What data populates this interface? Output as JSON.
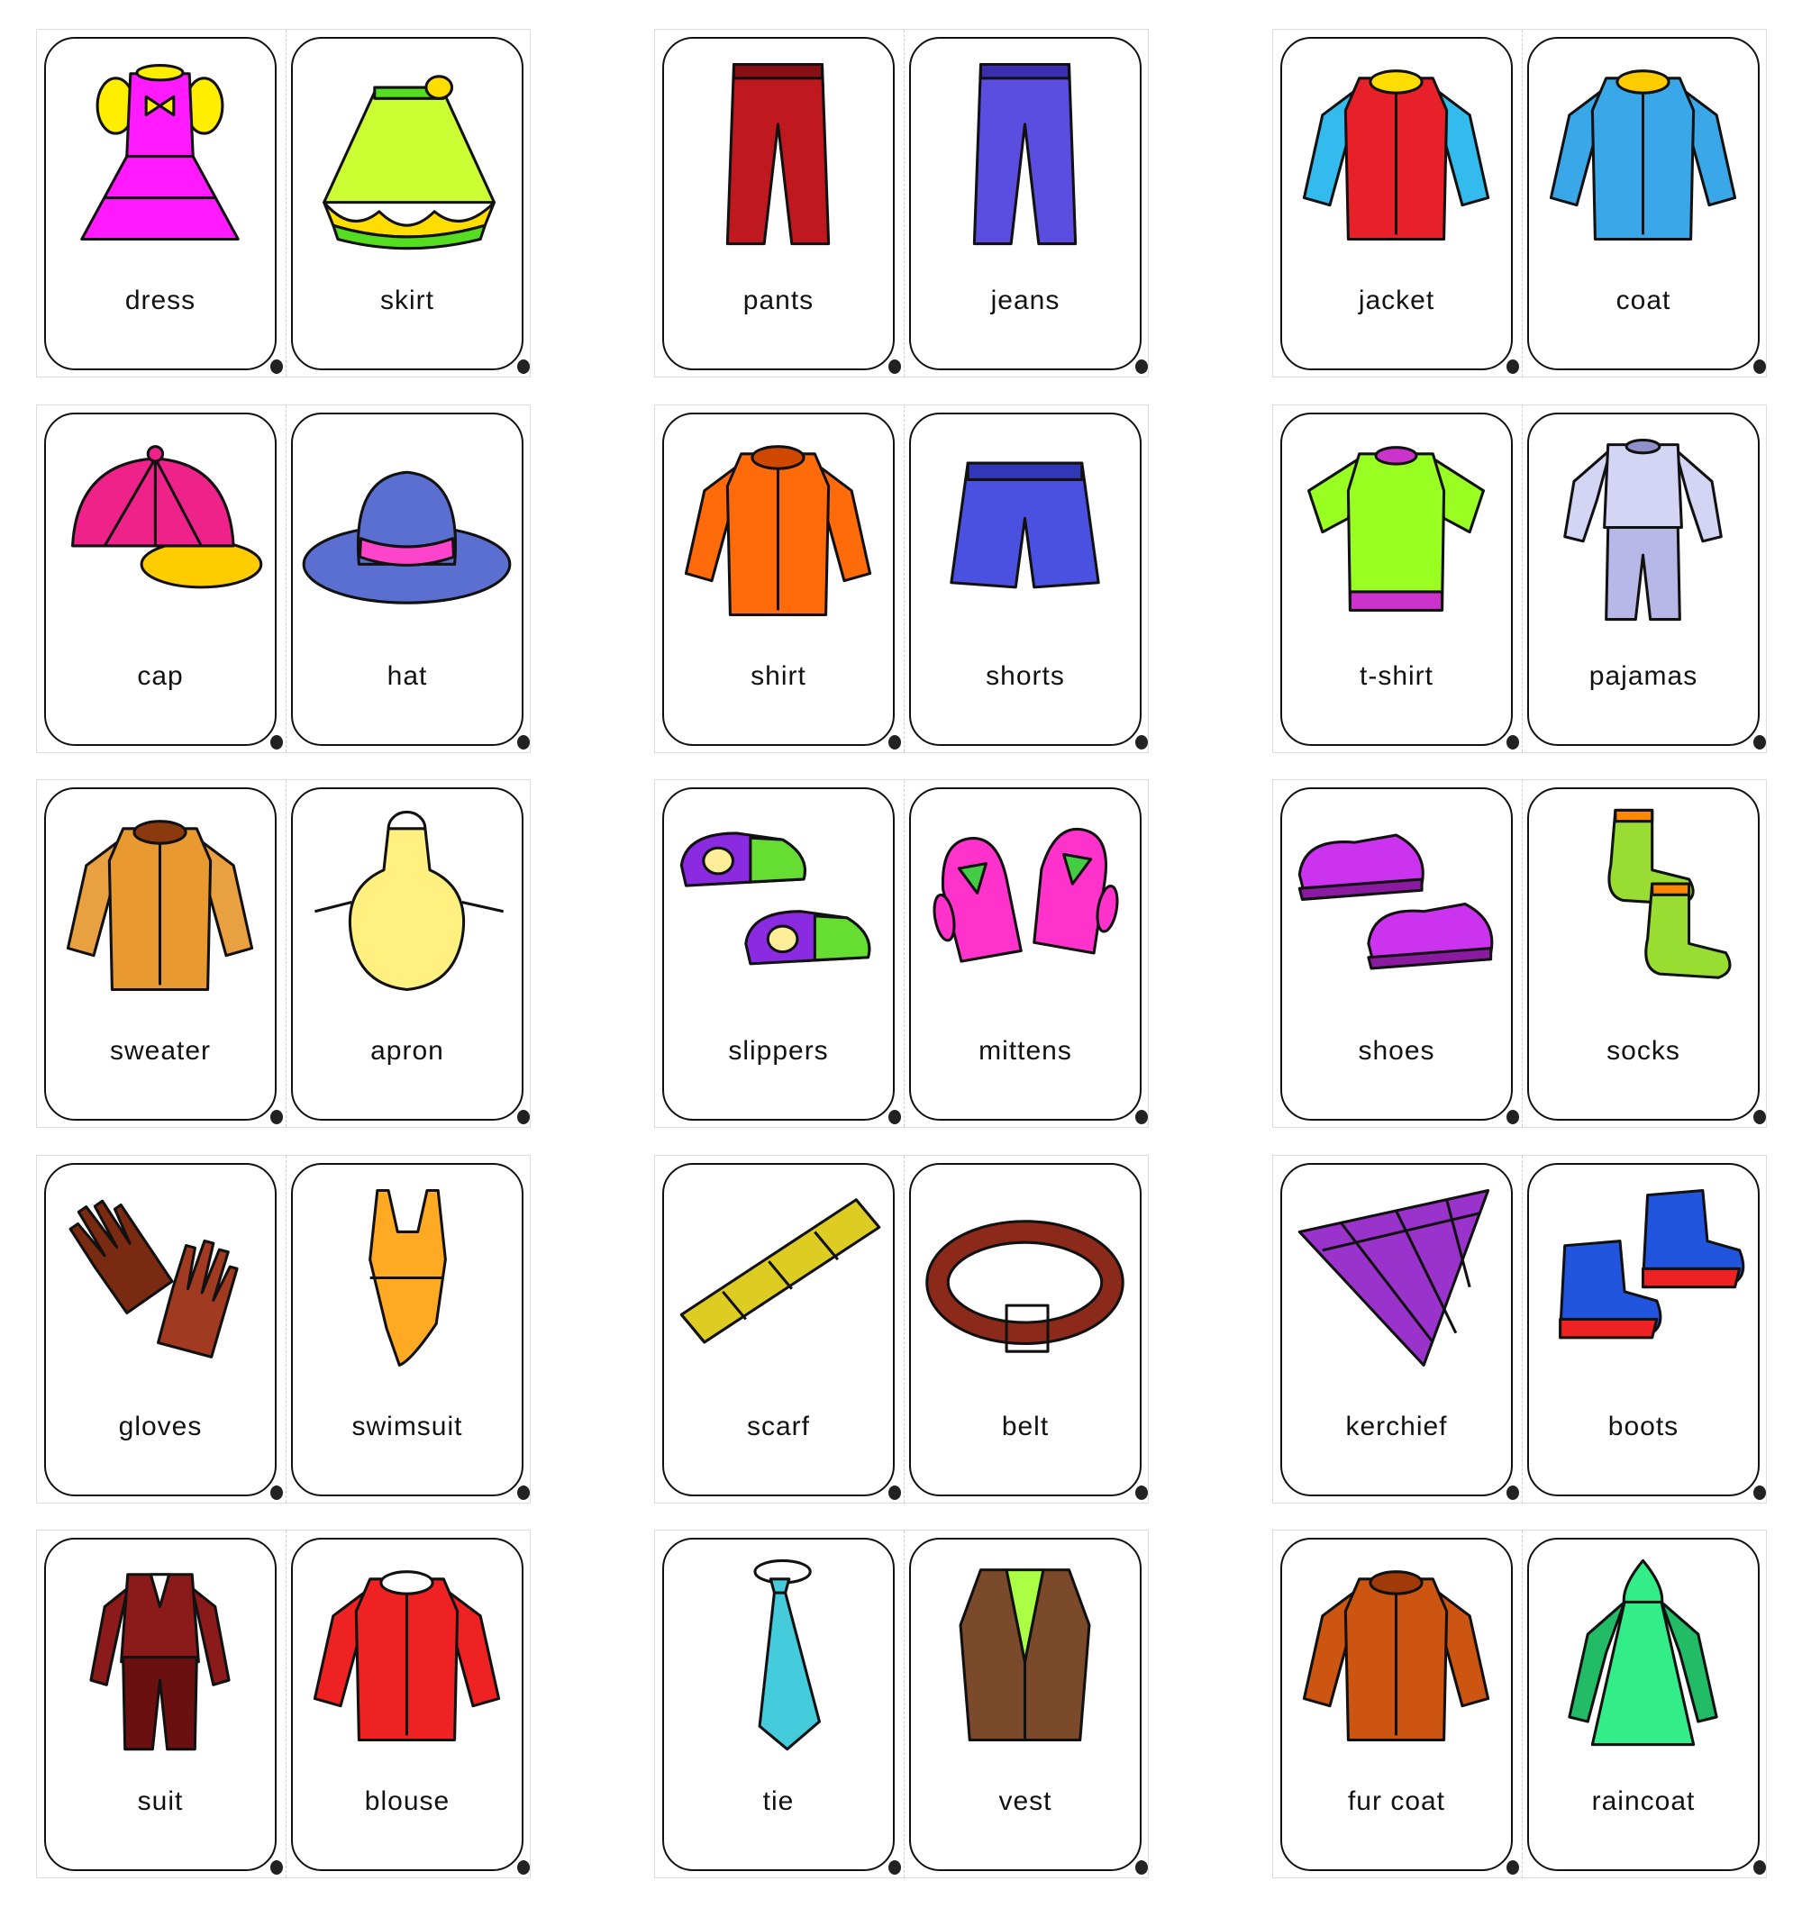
{
  "rows": [
    [
      {
        "label": "dress",
        "shape": "dress",
        "colors": [
          "#ff1aff",
          "#ffee00",
          "#b400c8"
        ]
      },
      {
        "label": "skirt",
        "shape": "skirt",
        "colors": [
          "#ccff33",
          "#ffdd00",
          "#55dd22"
        ]
      },
      {
        "label": "pants",
        "shape": "pants",
        "colors": [
          "#c0181f",
          "#8a0f14",
          "#8a0f14"
        ]
      },
      {
        "label": "jeans",
        "shape": "pants",
        "colors": [
          "#5b4de0",
          "#3a2fb0",
          "#3a2fb0"
        ]
      },
      {
        "label": "jacket",
        "shape": "top",
        "colors": [
          "#e8202a",
          "#33bbee",
          "#ffdd00"
        ]
      },
      {
        "label": "coat",
        "shape": "top",
        "colors": [
          "#3aa8e8",
          "#3aa8e8",
          "#ffcc00"
        ]
      }
    ],
    [
      {
        "label": "cap",
        "shape": "cap",
        "colors": [
          "#ee2288",
          "#ffcc00",
          "#ffee33"
        ]
      },
      {
        "label": "hat",
        "shape": "hat",
        "colors": [
          "#5a6fd0",
          "#ff44cc",
          "#4455bb"
        ]
      },
      {
        "label": "shirt",
        "shape": "top",
        "colors": [
          "#ff6a0a",
          "#ff6a0a",
          "#d04800"
        ]
      },
      {
        "label": "shorts",
        "shape": "shorts",
        "colors": [
          "#4a50e0",
          "#3038b8",
          "#3038b8"
        ]
      },
      {
        "label": "t-shirt",
        "shape": "tshirt",
        "colors": [
          "#99ff22",
          "#99ff22",
          "#cc33cc"
        ]
      },
      {
        "label": "pajamas",
        "shape": "pajamas",
        "colors": [
          "#d4d4f4",
          "#b8b8e8",
          "#9090c8"
        ]
      }
    ],
    [
      {
        "label": "sweater",
        "shape": "top",
        "colors": [
          "#e89a30",
          "#e8a040",
          "#8b3a10"
        ]
      },
      {
        "label": "apron",
        "shape": "apron",
        "colors": [
          "#fff080",
          "#ffcc00",
          "#ffcc00"
        ]
      },
      {
        "label": "slippers",
        "shape": "slippers",
        "colors": [
          "#8a2be2",
          "#66dd33",
          "#ffee99"
        ]
      },
      {
        "label": "mittens",
        "shape": "mittens",
        "colors": [
          "#ff33cc",
          "#44cc44",
          "#ff33cc"
        ]
      },
      {
        "label": "shoes",
        "shape": "shoes",
        "colors": [
          "#cc33ee",
          "#ffcc00",
          "#8a1aa0"
        ]
      },
      {
        "label": "socks",
        "shape": "socks",
        "colors": [
          "#99dd33",
          "#ff8800",
          "#ee3322"
        ]
      }
    ],
    [
      {
        "label": "gloves",
        "shape": "gloves",
        "colors": [
          "#7a2a10",
          "#5a1a08",
          "#a03a20"
        ]
      },
      {
        "label": "swimsuit",
        "shape": "swimsuit",
        "colors": [
          "#ffaa22",
          "#ff8800",
          "#33aa33"
        ]
      },
      {
        "label": "scarf",
        "shape": "scarf",
        "colors": [
          "#ddcc22",
          "#ee3322",
          "#66bb33"
        ]
      },
      {
        "label": "belt",
        "shape": "belt",
        "colors": [
          "#8b2a1a",
          "#e8c020",
          "#5a1a0a"
        ]
      },
      {
        "label": "kerchief",
        "shape": "kerchief",
        "colors": [
          "#9933cc",
          "#ffdd00",
          "#33aa33"
        ]
      },
      {
        "label": "boots",
        "shape": "boots",
        "colors": [
          "#2255dd",
          "#ee2222",
          "#ffcc00"
        ]
      }
    ],
    [
      {
        "label": "suit",
        "shape": "suit",
        "colors": [
          "#8b1a1a",
          "#6a1010",
          "#6a1010"
        ]
      },
      {
        "label": "blouse",
        "shape": "top",
        "colors": [
          "#ee2222",
          "#ee2222",
          "#ffffff"
        ]
      },
      {
        "label": "tie",
        "shape": "tie",
        "colors": [
          "#44ccdd",
          "#2299aa",
          "#2299aa"
        ]
      },
      {
        "label": "vest",
        "shape": "vest",
        "colors": [
          "#7a4a2a",
          "#aaff44",
          "#5a3018"
        ]
      },
      {
        "label": "fur coat",
        "shape": "top",
        "colors": [
          "#cc5511",
          "#cc5511",
          "#a03a08"
        ]
      },
      {
        "label": "raincoat",
        "shape": "raincoat",
        "colors": [
          "#33ee88",
          "#22bb66",
          "#22bb66"
        ]
      }
    ]
  ]
}
